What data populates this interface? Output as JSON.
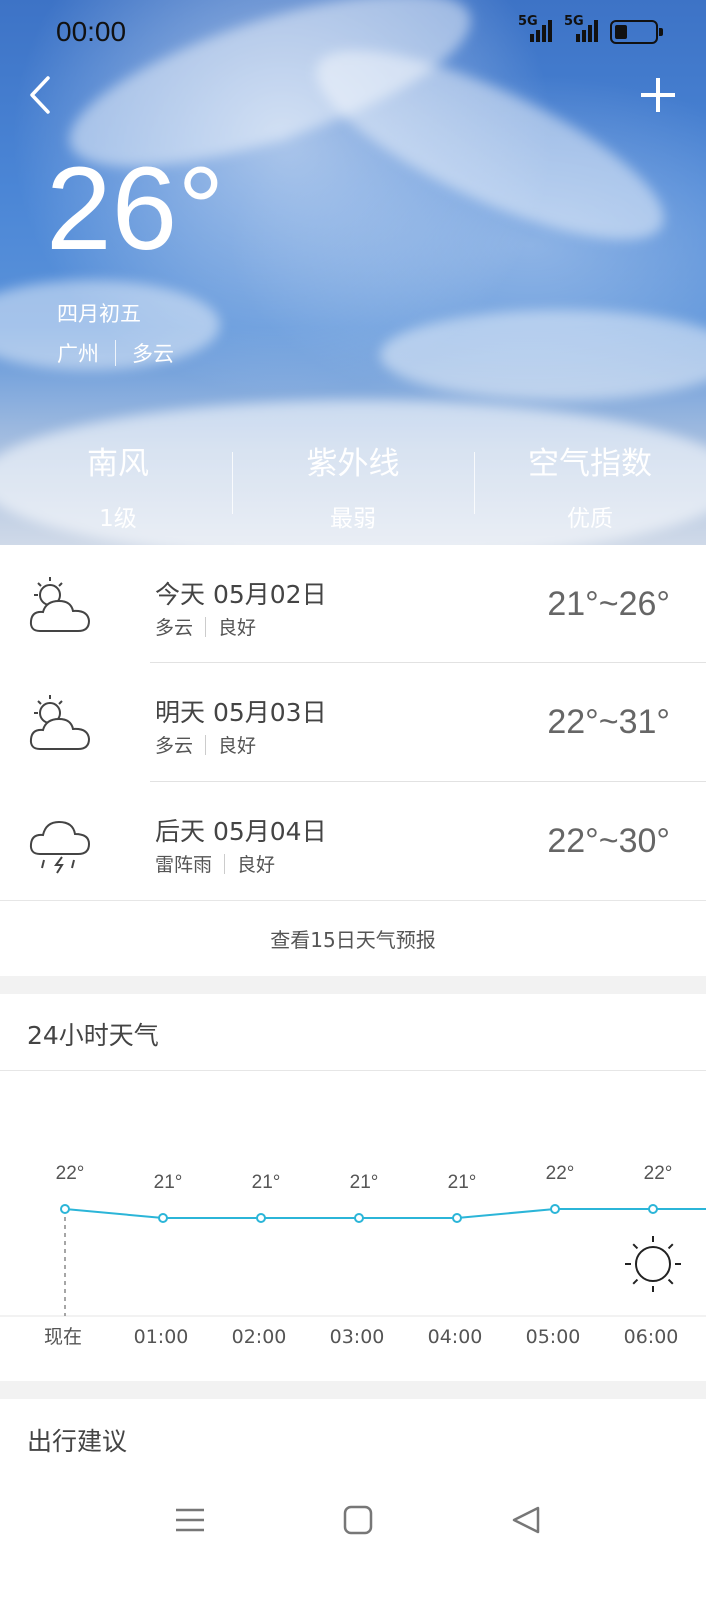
{
  "status": {
    "time": "00:00",
    "signal1": "5G",
    "signal2": "5G"
  },
  "hero": {
    "temperature": "26°",
    "lunar_date": "四月初五",
    "city": "广州",
    "condition": "多云",
    "stats": [
      {
        "label": "南风",
        "value": "1级"
      },
      {
        "label": "紫外线",
        "value": "最弱"
      },
      {
        "label": "空气指数",
        "value": "优质"
      }
    ]
  },
  "forecast": [
    {
      "date": "今天 05月02日",
      "condition": "多云",
      "air": "良好",
      "range": "21°~26°",
      "icon": "partly-cloudy-icon"
    },
    {
      "date": "明天 05月03日",
      "condition": "多云",
      "air": "良好",
      "range": "22°~31°",
      "icon": "partly-cloudy-icon"
    },
    {
      "date": "后天 05月04日",
      "condition": "雷阵雨",
      "air": "良好",
      "range": "22°~30°",
      "icon": "thunderstorm-icon"
    }
  ],
  "more_link": "查看15日天气预报",
  "hourly": {
    "title": "24小时天气",
    "chart_data": {
      "type": "line",
      "categories": [
        "现在",
        "01:00",
        "02:00",
        "03:00",
        "04:00",
        "05:00",
        "06:00"
      ],
      "series": [
        {
          "values": [
            22,
            21,
            21,
            21,
            21,
            22,
            22
          ]
        }
      ],
      "labels": [
        "22°",
        "21°",
        "21°",
        "21°",
        "21°",
        "22°",
        "22°"
      ],
      "line_color": "#2bb5d8",
      "icon_at_06": "sun-icon"
    }
  },
  "advice_title": "出行建议"
}
